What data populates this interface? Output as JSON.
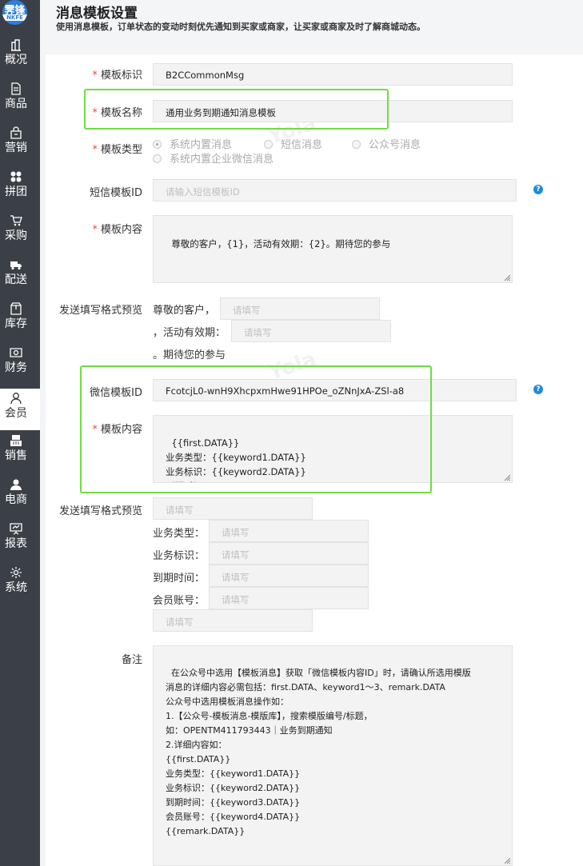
{
  "logo": {
    "line1": "霁锋",
    "line2": "NKFE"
  },
  "sidebar": {
    "items": [
      {
        "label": "概况",
        "icon": "building-icon"
      },
      {
        "label": "商品",
        "icon": "document-icon"
      },
      {
        "label": "营销",
        "icon": "bag-icon"
      },
      {
        "label": "拼团",
        "icon": "grid-icon"
      },
      {
        "label": "采购",
        "icon": "cart-icon"
      },
      {
        "label": "配送",
        "icon": "truck-icon"
      },
      {
        "label": "库存",
        "icon": "box-icon"
      },
      {
        "label": "财务",
        "icon": "money-icon"
      },
      {
        "label": "会员",
        "icon": "user-icon"
      },
      {
        "label": "销售",
        "icon": "register-icon"
      },
      {
        "label": "电商",
        "icon": "person-icon"
      },
      {
        "label": "报表",
        "icon": "chart-board-icon"
      },
      {
        "label": "系统",
        "icon": "gear-icon"
      }
    ],
    "active_index": 8
  },
  "header": {
    "title": "消息模板设置",
    "desc": "使用消息模板，订单状态的变动时刻优先通知到买家或商家，让买家或商家及时了解商城动态。"
  },
  "form": {
    "template_id_label": "模板标识",
    "template_id_value": "B2CCommonMsg",
    "template_name_label": "模板名称",
    "template_name_value": "通用业务到期通知消息模板",
    "template_type_label": "模板类型",
    "types": [
      "系统内置消息",
      "短信消息",
      "公众号消息",
      "系统内置企业微信消息"
    ],
    "sms_id_label": "短信模板ID",
    "sms_id_placeholder": "请输入短信模板ID",
    "content_label": "模板内容",
    "content_value": "尊敬的客户，{1}，活动有效期：{2}。期待您的参与",
    "preview_label": "发送填写格式预览",
    "sms_preview": {
      "prefix": "尊敬的客户，",
      "mid": "，活动有效期：",
      "suffix": "。期待您的参与",
      "placeholder": "请填写"
    },
    "wechat_id_label": "微信模板ID",
    "wechat_id_value": "FcotcjL0-wnH9XhcpxmHwe91HPOe_oZNnJxA-ZSl-a8",
    "wechat_content_label": "模板内容",
    "wechat_content_value": "{{first.DATA}}\n业务类型：{{keyword1.DATA}}\n业务标识：{{keyword2.DATA}}\n到期时间：{{keyword3.DATA}}\n会员账号：{{keyword4.DATA}}",
    "wechat_preview": {
      "placeholder": "请填写",
      "labels": [
        "业务类型：",
        "业务标识：",
        "到期时间：",
        "会员账号："
      ]
    },
    "remark_label": "备注",
    "remark_value": "在公众号中选用【模板消息】获取「微信模板内容ID」时，请确认所选用模版\n消息的详细内容必需包括：first.DATA、keyword1～3、remark.DATA\n公众号中选用模板消息操作如：\n1.【公众号-模板消息-模版库】，搜索模版编号/标题，\n如：OPENTM411793443｜业务到期通知\n2.详细内容如：\n{{first.DATA}}\n业务类型：{{keyword1.DATA}}\n业务标识：{{keyword2.DATA}}\n到期时间：{{keyword3.DATA}}\n会员账号：{{keyword4.DATA}}\n{{remark.DATA}}"
  },
  "help_glyph": "?",
  "watermark": "Yola"
}
